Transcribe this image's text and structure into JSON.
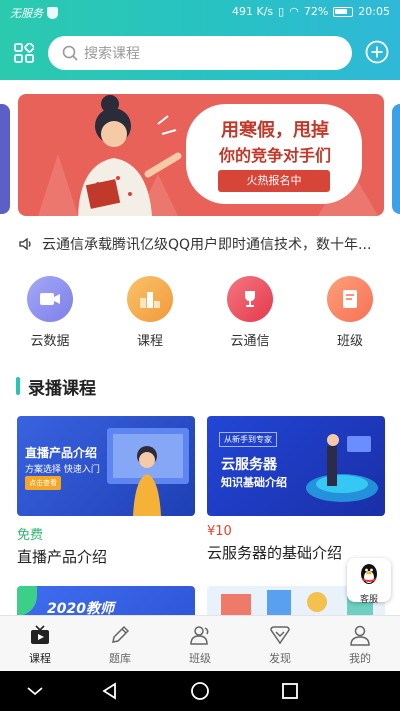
{
  "status_bar": {
    "carrier": "无服务",
    "speed": "491 K/s",
    "battery": "72%",
    "time": "20:05"
  },
  "header": {
    "search_placeholder": "搜索课程"
  },
  "banner": {
    "title": "用寒假，甩掉",
    "subtitle": "你的竞争对手们",
    "tag": "火热报名中"
  },
  "notice": {
    "text": "云通信承载腾讯亿级QQ用户即时通信技术，数十年..."
  },
  "categories": [
    {
      "label": "云数据",
      "icon": "video-camera-icon",
      "color": "#8e8ef2"
    },
    {
      "label": "课程",
      "icon": "podium-icon",
      "color": "#f5a84a"
    },
    {
      "label": "云通信",
      "icon": "trophy-icon",
      "color": "#ee5566"
    },
    {
      "label": "班级",
      "icon": "document-icon",
      "color": "#fb8a63"
    }
  ],
  "section": {
    "title": "录播课程"
  },
  "courses": [
    {
      "price": "免费",
      "price_color": "#2bb673",
      "title": "直播产品介绍",
      "thumb_title": "直播产品介绍",
      "thumb_sub": "方案选择 快速入门",
      "thumb_btn": "点击查看"
    },
    {
      "price": "¥10",
      "price_color": "#e8412c",
      "title": "云服务器的基础介绍",
      "thumb_tag": "从新手到专家",
      "thumb_line1": "云服务器",
      "thumb_line2": "知识基础介绍"
    },
    {
      "thumb_title": "2020教师"
    },
    {}
  ],
  "kefu": {
    "label": "客服"
  },
  "tabs": [
    {
      "label": "课程",
      "icon": "tv-icon",
      "active": true
    },
    {
      "label": "题库",
      "icon": "pencil-icon",
      "active": false
    },
    {
      "label": "班级",
      "icon": "group-icon",
      "active": false
    },
    {
      "label": "发现",
      "icon": "discover-icon",
      "active": false
    },
    {
      "label": "我的",
      "icon": "user-icon",
      "active": false
    }
  ]
}
